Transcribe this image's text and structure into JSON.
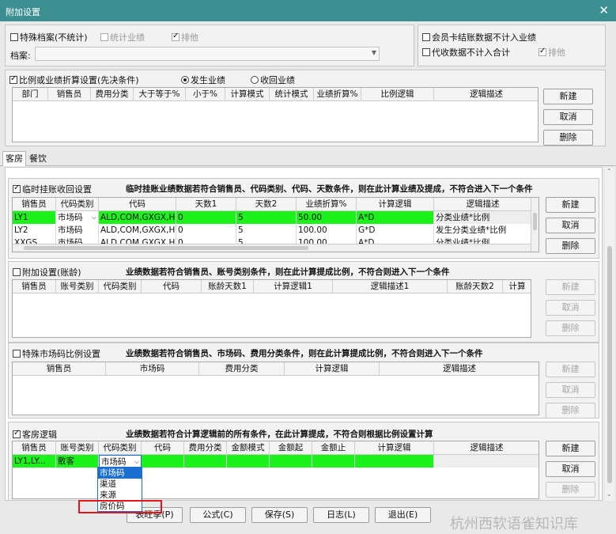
{
  "window": {
    "title": "附加设置",
    "close": "✕"
  },
  "top": {
    "special_archive": "特殊档案(不统计)",
    "stat_perf": "统计业绩",
    "exclude": "排他",
    "archive_label": "档案:",
    "member_card": "会员卡结账数据不计入业绩",
    "agent_data": "代收数据不计入合计",
    "exclude2": "排他"
  },
  "ratio": {
    "title": "比例或业绩折算设置(先决条件)",
    "radio1": "发生业绩",
    "radio2": "收回业绩",
    "headers": [
      "部门",
      "销售员",
      "费用分类",
      "大于等于%",
      "小于%",
      "计算模式",
      "统计模式",
      "业绩折算%",
      "比例逻辑",
      "逻辑描述"
    ],
    "buttons": [
      "新建",
      "取消",
      "删除"
    ]
  },
  "tabs": [
    "客房",
    "餐饮"
  ],
  "temp": {
    "title": "临时挂账收回设置",
    "desc": "临时挂账业绩数据若符合销售员、代码类别、代码、天数条件，则在此计算业绩及提成，不符合进入下一个条件",
    "headers": [
      "销售员",
      "代码类别",
      "代码",
      "天数1",
      "天数2",
      "业绩折算%",
      "计算逻辑",
      "逻辑描述"
    ],
    "rows": [
      [
        "LY1",
        "市场码",
        "ALD,COM,GXGX,H...",
        "0",
        "5",
        "50.00",
        "A*D",
        "分类业绩*比例"
      ],
      [
        "LY2",
        "市场码",
        "ALD,COM,GXGX,H...",
        "0",
        "5",
        "100.00",
        "G*D",
        "发生分类业绩*比例"
      ],
      [
        "XXGS",
        "市场码",
        "ALD,COM,GXGX,H...",
        "0",
        "5",
        "100.00",
        "A*D",
        "分类业绩*比例"
      ]
    ],
    "buttons": [
      "新建",
      "取消",
      "删除"
    ]
  },
  "aging": {
    "title": "附加设置(账龄)",
    "desc": "业绩数据若符合销售员、账号类别条件，则在此计算提成比例，不符合则进入下一个条件",
    "headers": [
      "销售员",
      "账号类别",
      "代码类别",
      "代码",
      "账龄天数1",
      "计算逻辑1",
      "逻辑描述1",
      "账龄天数2",
      "计算"
    ],
    "buttons": [
      "新建",
      "取消",
      "删除"
    ]
  },
  "special": {
    "title": "特殊市场码比例设置",
    "desc": "业绩数据若符合销售员、市场码、费用分类条件，则在此计算提成比例，不符合则进入下一个条件",
    "headers": [
      "销售员",
      "市场码",
      "费用分类",
      "计算逻辑",
      "逻辑描述"
    ],
    "buttons": [
      "新建",
      "取消",
      "删除"
    ]
  },
  "room": {
    "title": "客房逻辑",
    "desc": "业绩数据若符合计算逻辑前的所有条件，在此计算提成，不符合则根据比例设置计算",
    "headers": [
      "销售员",
      "账号类别",
      "代码类别",
      "代码",
      "费用分类",
      "金额模式",
      "金额起",
      "金额止",
      "计算逻辑",
      "逻辑描述"
    ],
    "row": [
      "LY1,LY...",
      "散客",
      "市场码"
    ],
    "dropdown": [
      "市场码",
      "渠道",
      "来源",
      "房价码"
    ],
    "buttons": [
      "新建",
      "取消",
      "删除"
    ]
  },
  "bottom": {
    "buttons": [
      "表旺季(P)",
      "公式(C)",
      "保存(S)",
      "日志(L)",
      "退出(E)"
    ],
    "watermark": "杭州西软语雀知识库"
  }
}
